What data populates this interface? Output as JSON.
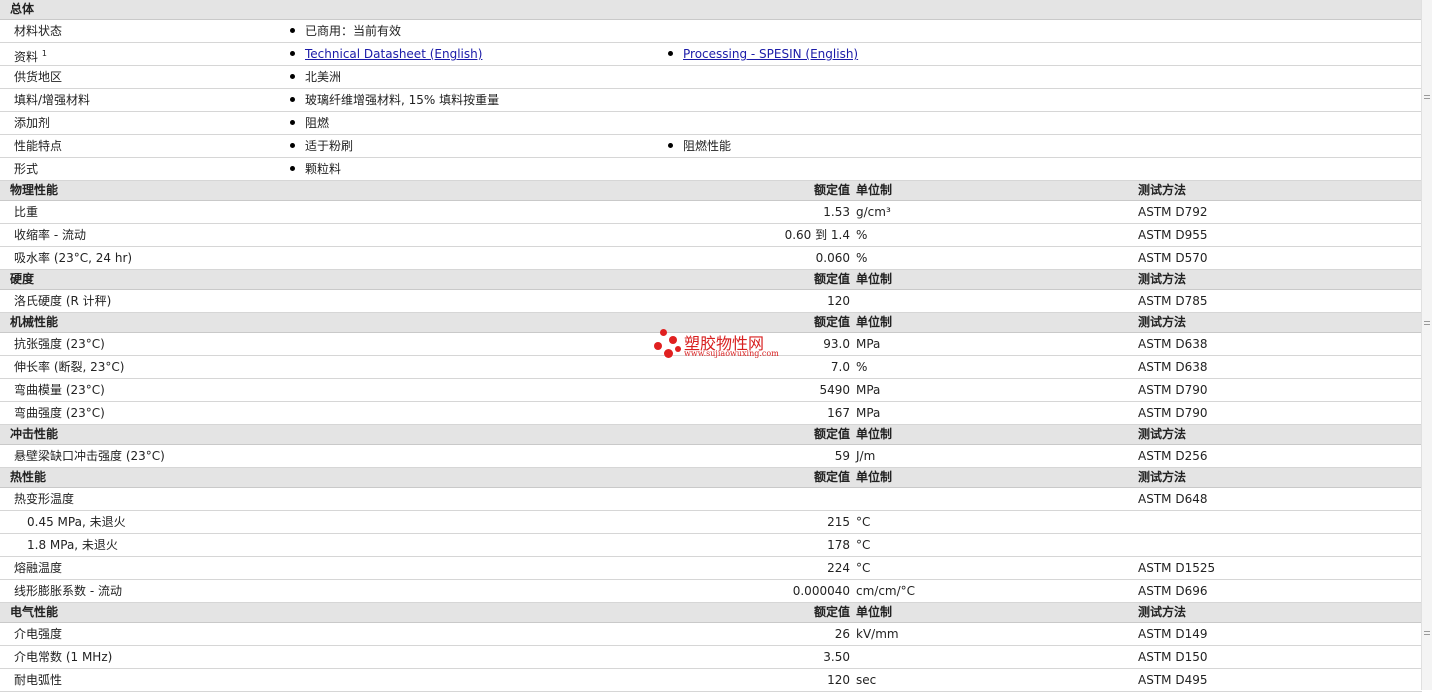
{
  "overview": {
    "title": "总体",
    "rows": [
      {
        "name": "材料状态",
        "b1": "已商用：当前有效"
      },
      {
        "name": "资料",
        "sup": "1",
        "b1": "Technical Datasheet (English)",
        "b2": "Processing - SPESIN (English)",
        "links": true
      },
      {
        "name": "供货地区",
        "b1": "北美洲"
      },
      {
        "name": "填料/增强材料",
        "b1": "玻璃纤维增强材料, 15% 填料按重量"
      },
      {
        "name": "添加剂",
        "b1": "阻燃"
      },
      {
        "name": "性能特点",
        "b1": "适于粉刷",
        "b2": "阻燃性能"
      },
      {
        "name": "形式",
        "b1": "颗粒料"
      }
    ]
  },
  "column_labels": {
    "nominal": "额定值",
    "unit": "单位制",
    "test": "测试方法"
  },
  "sections": [
    {
      "title": "物理性能",
      "rows": [
        {
          "name": "比重",
          "val": "1.53",
          "unit": "g/cm³",
          "test": "ASTM D792"
        },
        {
          "name": "收缩率  - 流动",
          "val": "0.60 到  1.4",
          "unit": "%",
          "test": "ASTM D955"
        },
        {
          "name": "吸水率  (23°C, 24 hr)",
          "val": "0.060",
          "unit": "%",
          "test": "ASTM D570"
        }
      ]
    },
    {
      "title": "硬度",
      "rows": [
        {
          "name": "洛氏硬度  (R 计秤)",
          "val": "120",
          "unit": "",
          "test": "ASTM D785"
        }
      ]
    },
    {
      "title": "机械性能",
      "rows": [
        {
          "name": "抗张强度  (23°C)",
          "val": "93.0",
          "unit": "MPa",
          "test": "ASTM D638"
        },
        {
          "name": "伸长率  (断裂, 23°C)",
          "val": "7.0",
          "unit": "%",
          "test": "ASTM D638"
        },
        {
          "name": "弯曲模量  (23°C)",
          "val": "5490",
          "unit": "MPa",
          "test": "ASTM D790"
        },
        {
          "name": "弯曲强度  (23°C)",
          "val": "167",
          "unit": "MPa",
          "test": "ASTM D790"
        }
      ]
    },
    {
      "title": "冲击性能",
      "rows": [
        {
          "name": "悬壁梁缺口冲击强度  (23°C)",
          "val": "59",
          "unit": "J/m",
          "test": "ASTM D256"
        }
      ]
    },
    {
      "title": "热性能",
      "rows": [
        {
          "name": "热变形温度",
          "val": "",
          "unit": "",
          "test": "ASTM D648"
        },
        {
          "name": "0.45 MPa, 未退火",
          "val": "215",
          "unit": "°C",
          "test": "",
          "sub": true
        },
        {
          "name": "1.8 MPa, 未退火",
          "val": "178",
          "unit": "°C",
          "test": "",
          "sub": true
        },
        {
          "name": "熔融温度",
          "val": "224",
          "unit": "°C",
          "test": "ASTM D1525"
        },
        {
          "name": "线形膨胀系数  - 流动",
          "val": "0.000040",
          "unit": "cm/cm/°C",
          "test": "ASTM D696"
        }
      ]
    },
    {
      "title": "电气性能",
      "rows": [
        {
          "name": "介电强度",
          "val": "26",
          "unit": "kV/mm",
          "test": "ASTM D149"
        },
        {
          "name": "介电常数  (1 MHz)",
          "val": "3.50",
          "unit": "",
          "test": "ASTM D150"
        },
        {
          "name": "耐电弧性",
          "val": "120",
          "unit": "sec",
          "test": "ASTM D495"
        }
      ]
    }
  ],
  "watermark": {
    "title": "塑胶物性网",
    "url": "www.sujiaowuxing.com",
    "color": "#e02020"
  }
}
